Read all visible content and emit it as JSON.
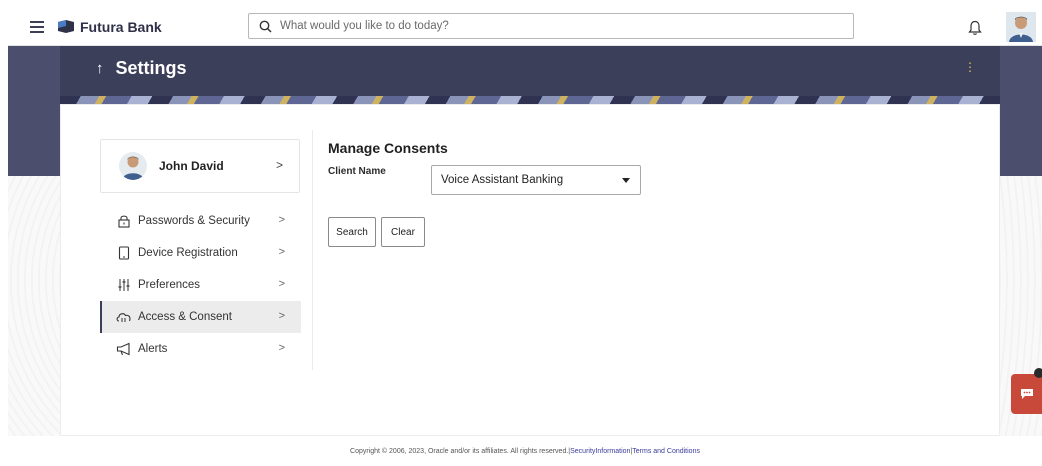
{
  "app": {
    "name": "Futura Bank"
  },
  "search": {
    "placeholder": "What would you like to do today?"
  },
  "header": {
    "title": "Settings",
    "back_icon": "arrow-up-icon"
  },
  "profile": {
    "name": "John David"
  },
  "sidebar": {
    "items": [
      {
        "label": "Passwords & Security",
        "icon": "lock-icon",
        "active": false
      },
      {
        "label": "Device Registration",
        "icon": "device-icon",
        "active": false
      },
      {
        "label": "Preferences",
        "icon": "sliders-icon",
        "active": false
      },
      {
        "label": "Access & Consent",
        "icon": "cloud-consent-icon",
        "active": true
      },
      {
        "label": "Alerts",
        "icon": "megaphone-icon",
        "active": false
      }
    ]
  },
  "main": {
    "section_title": "Manage Consents",
    "client_name_label": "Client Name",
    "client_name_value": "Voice Assistant Banking",
    "search_button": "Search",
    "clear_button": "Clear"
  },
  "footer": {
    "copyright": "Copyright © 2006, 2023, Oracle and/or its affiliates. All rights reserved.",
    "security_link": "SecurityInformation",
    "terms_link": "Terms and Conditions",
    "separator": "|"
  },
  "colors": {
    "header_band": "#4b4e6d",
    "accent_kebab": "#e7c35a",
    "chat_button": "#c8483a"
  }
}
